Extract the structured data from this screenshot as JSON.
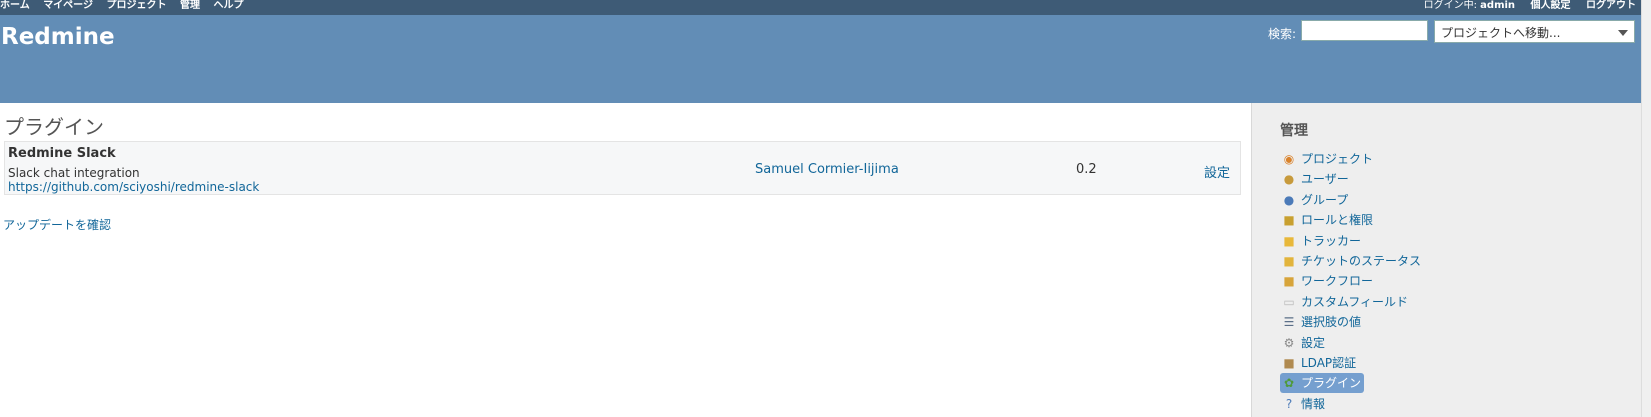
{
  "top_menu": {
    "items": [
      "ホーム",
      "マイページ",
      "プロジェクト",
      "管理",
      "ヘルプ"
    ],
    "logged_as_label": "ログイン中:",
    "user": "admin",
    "my_account": "個人設定",
    "logout": "ログアウト"
  },
  "header": {
    "title": "Redmine",
    "search_label": "検索:",
    "search_value": "",
    "jump_label": "プロジェクトへ移動..."
  },
  "main": {
    "heading": "プラグイン",
    "plugin": {
      "name": "Redmine Slack",
      "description": "Slack chat integration",
      "url": "https://github.com/sciyoshi/redmine-slack",
      "author": "Samuel Cormier-Iijima",
      "version": "0.2",
      "configure_label": "設定"
    },
    "check_updates": "アップデートを確認"
  },
  "sidebar": {
    "heading": "管理",
    "items": [
      {
        "label": "プロジェクト",
        "icon": "projects-icon",
        "glyph": "◉",
        "color": "#d9822b"
      },
      {
        "label": "ユーザー",
        "icon": "user-icon",
        "glyph": "●",
        "color": "#c79a3c"
      },
      {
        "label": "グループ",
        "icon": "group-icon",
        "glyph": "●",
        "color": "#4b7ab8"
      },
      {
        "label": "ロールと権限",
        "icon": "roles-icon",
        "glyph": "■",
        "color": "#c8a030"
      },
      {
        "label": "トラッカー",
        "icon": "tracker-icon",
        "glyph": "■",
        "color": "#e8b83a"
      },
      {
        "label": "チケットのステータス",
        "icon": "status-icon",
        "glyph": "■",
        "color": "#e2b43c"
      },
      {
        "label": "ワークフロー",
        "icon": "workflow-icon",
        "glyph": "■",
        "color": "#d7a43a"
      },
      {
        "label": "カスタムフィールド",
        "icon": "custom-fields-icon",
        "glyph": "▭",
        "color": "#bbbbbb"
      },
      {
        "label": "選択肢の値",
        "icon": "list-icon",
        "glyph": "☰",
        "color": "#5b6f88"
      },
      {
        "label": "設定",
        "icon": "settings-gear-icon",
        "glyph": "⚙",
        "color": "#888888"
      },
      {
        "label": "LDAP認証",
        "icon": "ldap-icon",
        "glyph": "■",
        "color": "#b08a50"
      },
      {
        "label": "プラグイン",
        "icon": "plugin-icon",
        "glyph": "✿",
        "color": "#4f9a3a",
        "selected": true
      },
      {
        "label": "情報",
        "icon": "info-icon",
        "glyph": "?",
        "color": "#4b7ab8"
      }
    ]
  }
}
